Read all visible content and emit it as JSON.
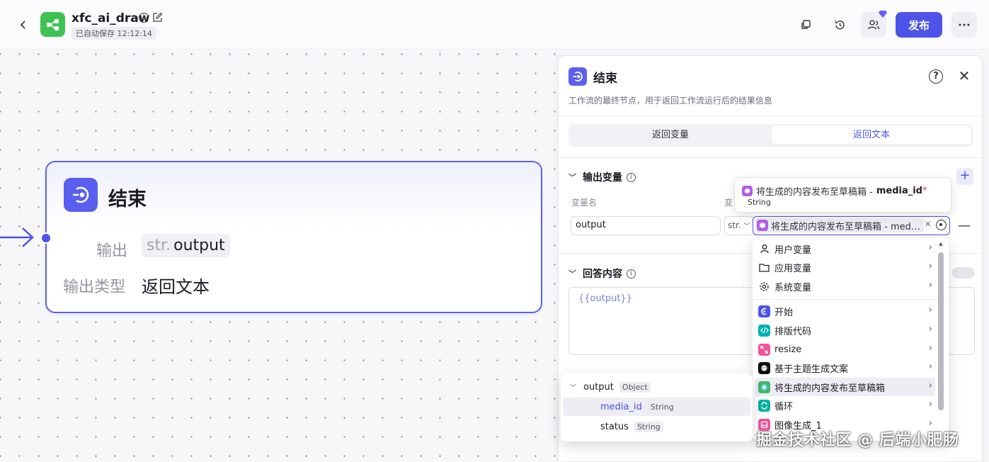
{
  "header": {
    "app_title": "xfc_ai_draw",
    "autosave": "已自动保存 12:12:14",
    "publish_label": "发布"
  },
  "node": {
    "title": "结束",
    "output_label": "输出",
    "output_type": "str.",
    "output_var": "output",
    "output_kind_label": "输出类型",
    "output_kind_value": "返回文本"
  },
  "panel": {
    "title": "结束",
    "description": "工作流的最终节点，用于返回工作流运行后的结果信息",
    "tabs": [
      {
        "label": "返回变量",
        "active": false
      },
      {
        "label": "返回文本",
        "active": true
      }
    ],
    "output_section": {
      "title": "输出变量",
      "col_name": "变量名",
      "col_value_prefix": "变",
      "var_name_value": "output",
      "type_value": "str.",
      "ref_value": "将生成的内容发布至草稿箱 - med…"
    },
    "answer_section": {
      "title": "回答内容",
      "content": "{{output}}"
    }
  },
  "tooltip": {
    "path": "将生成的内容发布至草稿箱 - ",
    "field": "media_id",
    "required_mark": "*",
    "type": "String"
  },
  "menu": {
    "items": [
      {
        "label": "用户变量",
        "icon": "user-icon"
      },
      {
        "label": "应用变量",
        "icon": "folder-icon"
      },
      {
        "label": "系统变量",
        "icon": "gear-icon"
      },
      {
        "label": "开始",
        "icon": "start-node-icon",
        "color": "#4d53e8"
      },
      {
        "label": "排版代码",
        "icon": "code-node-icon",
        "color": "#00b2b2"
      },
      {
        "label": "resize",
        "icon": "resize-node-icon",
        "color": "#f0549a"
      },
      {
        "label": "基于主题生成文案",
        "icon": "llm-node-icon",
        "color": "#111111"
      },
      {
        "label": "将生成的内容发布至草稿箱",
        "icon": "plugin-node-icon",
        "color": "#3fb86e"
      },
      {
        "label": "循环",
        "icon": "loop-node-icon",
        "color": "#00b2a0"
      },
      {
        "label": "图像生成_1",
        "icon": "image-node-icon",
        "color": "#f0549a"
      }
    ]
  },
  "submenu": {
    "parent": {
      "label": "output",
      "type": "Object"
    },
    "children": [
      {
        "label": "media_id",
        "type": "String"
      },
      {
        "label": "status",
        "type": "String"
      }
    ]
  },
  "watermark": "掘金技术社区 @ 后端小肥肠",
  "colors": {
    "accent": "#4d53e8",
    "app_logo": "#3ec254"
  }
}
